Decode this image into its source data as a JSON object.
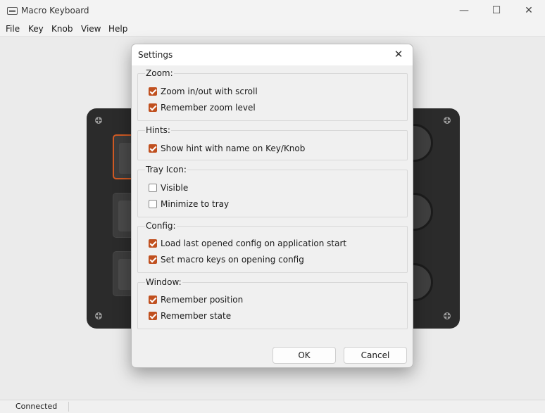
{
  "window": {
    "title": "Macro Keyboard",
    "controls": {
      "minimize": "—",
      "maximize": "☐",
      "close": "✕"
    }
  },
  "menu": [
    "File",
    "Key",
    "Knob",
    "View",
    "Help"
  ],
  "status": {
    "text": "Connected"
  },
  "device": {
    "selected_key_color": "#d05a24",
    "body_color": "#2b2b2b"
  },
  "dialog": {
    "title": "Settings",
    "close": "✕",
    "accent": "#c0501f",
    "groups": [
      {
        "title": "Zoom:",
        "options": [
          {
            "label": "Zoom in/out with scroll",
            "checked": true
          },
          {
            "label": "Remember zoom level",
            "checked": true
          }
        ]
      },
      {
        "title": "Hints:",
        "options": [
          {
            "label": "Show hint with name on Key/Knob",
            "checked": true
          }
        ]
      },
      {
        "title": "Tray Icon:",
        "options": [
          {
            "label": "Visible",
            "checked": false
          },
          {
            "label": "Minimize to tray",
            "checked": false
          }
        ]
      },
      {
        "title": "Config:",
        "options": [
          {
            "label": "Load last opened config on application start",
            "checked": true
          },
          {
            "label": "Set macro keys on opening config",
            "checked": true
          }
        ]
      },
      {
        "title": "Window:",
        "options": [
          {
            "label": "Remember position",
            "checked": true
          },
          {
            "label": "Remember state",
            "checked": true
          }
        ]
      }
    ],
    "ok_label": "OK",
    "cancel_label": "Cancel"
  }
}
